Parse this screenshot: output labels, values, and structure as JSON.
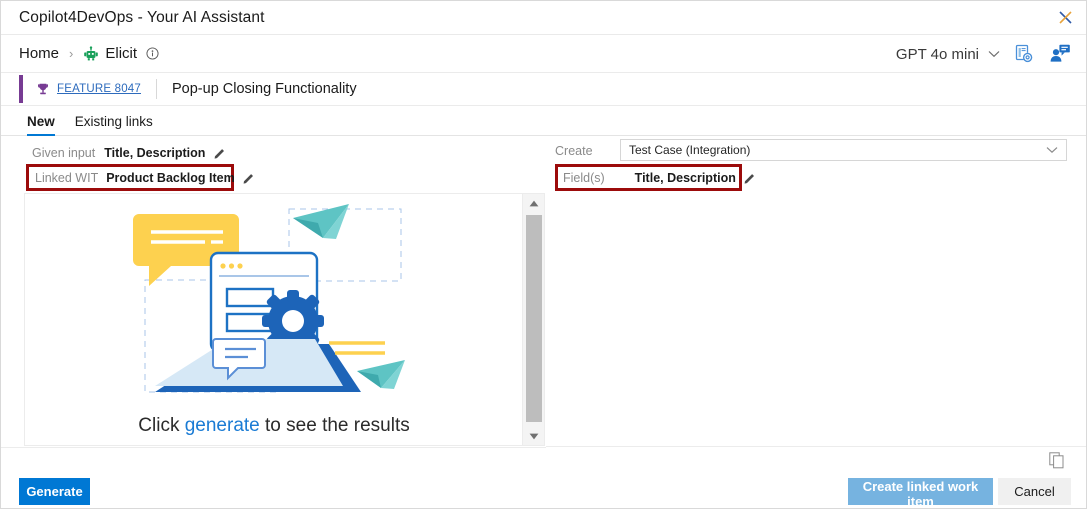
{
  "window": {
    "title": "Copilot4DevOps - Your AI Assistant",
    "close_icon": "close-icon"
  },
  "nav": {
    "home_label": "Home",
    "separator": "›",
    "current_label": "Elicit",
    "elicit_icon": "robot-icon",
    "info_icon": "info-circle-icon",
    "model": {
      "label": "GPT 4o mini",
      "chevron_icon": "chevron-down-icon"
    },
    "settings_icon": "document-gear-icon",
    "feedback_icon": "person-feedback-icon"
  },
  "work_item": {
    "type_icon": "trophy-icon",
    "id_label": "FEATURE 8047",
    "title": "Pop-up Closing Functionality",
    "accent_color": "#773b93"
  },
  "tabs": [
    {
      "label": "New",
      "active": true
    },
    {
      "label": "Existing links",
      "active": false
    }
  ],
  "form": {
    "left": {
      "given_input": {
        "label": "Given input",
        "value": "Title, Description",
        "edit_icon": "pencil-icon"
      },
      "linked_wit": {
        "label": "Linked WIT",
        "value": "Product Backlog Item",
        "edit_icon": "pencil-icon",
        "highlight_color": "#9c0b0b"
      }
    },
    "right": {
      "create": {
        "label": "Create",
        "selected": "Test Case (Integration)",
        "chevron_icon": "chevron-down-icon"
      },
      "fields": {
        "label": "Field(s)",
        "value": "Title, Description",
        "edit_icon": "pencil-icon",
        "highlight_color": "#9c0b0b"
      }
    }
  },
  "results": {
    "caption_prefix": "Click ",
    "caption_link": "generate",
    "caption_suffix": " to see the results",
    "link_color": "#1a7bd4",
    "scrollbar": {
      "up_icon": "scroll-up-arrow-icon",
      "down_icon": "scroll-down-arrow-icon"
    }
  },
  "footer": {
    "generate_label": "Generate",
    "create_linked_label": "Create linked work item",
    "cancel_label": "Cancel",
    "copy_icon": "copy-icon",
    "primary_color": "#0078d4",
    "disabled_color": "#76b3e0"
  }
}
